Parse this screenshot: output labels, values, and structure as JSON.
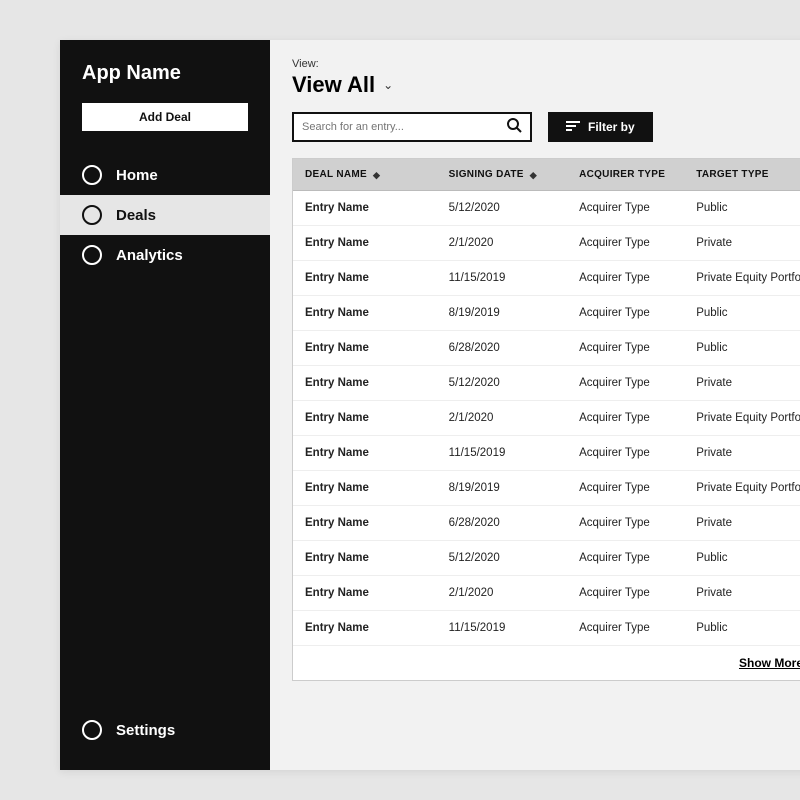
{
  "app": {
    "title": "App Name",
    "add_button": "Add Deal"
  },
  "nav": {
    "items": [
      {
        "label": "Home"
      },
      {
        "label": "Deals"
      },
      {
        "label": "Analytics"
      }
    ],
    "bottom": {
      "label": "Settings"
    },
    "active_index": 1
  },
  "view": {
    "label": "View:",
    "current": "View All"
  },
  "search": {
    "placeholder": "Search for an entry..."
  },
  "filter_button": "Filter by",
  "columns": {
    "deal_name": "DEAL NAME",
    "signing_date": "SIGNING DATE",
    "acquirer_type": "ACQUIRER TYPE",
    "target_type": "TARGET TYPE"
  },
  "rows": [
    {
      "name": "Entry Name",
      "date": "5/12/2020",
      "acquirer": "Acquirer Type",
      "target": "Public"
    },
    {
      "name": "Entry Name",
      "date": "2/1/2020",
      "acquirer": "Acquirer Type",
      "target": "Private"
    },
    {
      "name": "Entry Name",
      "date": "11/15/2019",
      "acquirer": "Acquirer Type",
      "target": "Private Equity Portfolio"
    },
    {
      "name": "Entry Name",
      "date": "8/19/2019",
      "acquirer": "Acquirer Type",
      "target": "Public"
    },
    {
      "name": "Entry Name",
      "date": "6/28/2020",
      "acquirer": "Acquirer Type",
      "target": "Public"
    },
    {
      "name": "Entry Name",
      "date": "5/12/2020",
      "acquirer": "Acquirer Type",
      "target": "Private"
    },
    {
      "name": "Entry Name",
      "date": "2/1/2020",
      "acquirer": "Acquirer Type",
      "target": "Private Equity Portfolio"
    },
    {
      "name": "Entry Name",
      "date": "11/15/2019",
      "acquirer": "Acquirer Type",
      "target": "Private"
    },
    {
      "name": "Entry Name",
      "date": "8/19/2019",
      "acquirer": "Acquirer Type",
      "target": "Private Equity Portfolio"
    },
    {
      "name": "Entry Name",
      "date": "6/28/2020",
      "acquirer": "Acquirer Type",
      "target": "Private"
    },
    {
      "name": "Entry Name",
      "date": "5/12/2020",
      "acquirer": "Acquirer Type",
      "target": "Public"
    },
    {
      "name": "Entry Name",
      "date": "2/1/2020",
      "acquirer": "Acquirer Type",
      "target": "Private"
    },
    {
      "name": "Entry Name",
      "date": "11/15/2019",
      "acquirer": "Acquirer Type",
      "target": "Public"
    }
  ],
  "show_more": "Show More"
}
